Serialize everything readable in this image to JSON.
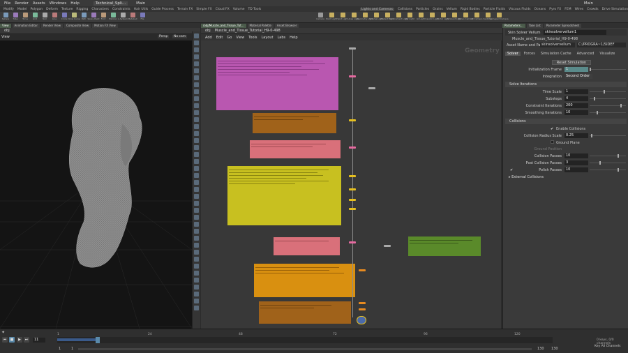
{
  "menu": [
    "File",
    "Render",
    "Assets",
    "Windows",
    "Help"
  ],
  "desktop": {
    "tab": "Technical_Spli...",
    "main": "Main",
    "right_main": "Main"
  },
  "shelf_tabs_left": [
    "Modify",
    "Model",
    "Polygon",
    "Deform",
    "Texture",
    "Rigging",
    "Characters",
    "Constraints",
    "Hair Utils",
    "Guide Process",
    "Terrain FX",
    "Simple FX",
    "Cloud FX",
    "Volume",
    "TD Tools"
  ],
  "shelf_tabs_right": [
    "Lights and Cameras",
    "Collisions",
    "Particles",
    "Grains",
    "Vellum",
    "Rigid Bodies",
    "Particle Fluids",
    "Viscous Fluids",
    "Oceans",
    "Pyro FX",
    "FEM",
    "Wires",
    "Crowds",
    "Drive Simulation"
  ],
  "shelf_tools_left": [
    "Sphere",
    "Tube",
    "Torus",
    "Grid",
    "Null",
    "Line",
    "Circle",
    "Draw Curve",
    "Path",
    "Spray Paint",
    "Font",
    "Platonic",
    "L-System",
    "Metaball",
    "File"
  ],
  "shelf_tools_right": [
    "Camera",
    "Point Light",
    "Spot Light",
    "Area Light",
    "Geometry Light",
    "Volume Light",
    "Distant Light",
    "Environment Light",
    "Sky Light",
    "GI Light",
    "Caustic Light",
    "Portal Light",
    "Ambient Light",
    "Stereo Camera",
    "VR Camera",
    "Switcher",
    "Gamepad Camera"
  ],
  "left_tabs": [
    "View",
    "Animation Editor",
    "Render View",
    "Composite View",
    "Motion FX View"
  ],
  "left_path": "obj",
  "viewport": {
    "persp": "Persp",
    "cam": "No cam"
  },
  "network_tabs": [
    "/obj/Muscle_and_Tissue_Tut...",
    "Material Palette",
    "Asset Browser"
  ],
  "network_path": [
    "obj",
    "Muscle_and_Tissue_Tutorial_H9-0-498"
  ],
  "network_menu": [
    "Add",
    "Edit",
    "Go",
    "View",
    "Tools",
    "Layout",
    "Labs",
    "Help"
  ],
  "network_watermark": "Geometry",
  "right_top_tabs": [
    "Take List",
    "Parameter Spreadsheet"
  ],
  "params": {
    "tabs_top": [
      "Parameters..."
    ],
    "node_type": "Skin Solver Vellum",
    "node_name": "skinsolvervellum1",
    "path_label": "Muscle_and_Tissue_Tutorial_H9-0-498",
    "asset_label": "Asset Name and Path",
    "asset_value": "skinsolvervellum",
    "asset_path": "C:/PROGRA~1/SIDEF",
    "tabs": [
      "Solver",
      "Forces",
      "Simulation Cache",
      "Advanced",
      "Visualize"
    ],
    "reset_button": "Reset Simulation",
    "init_frame_label": "Initialization Frame",
    "init_frame_value": "1",
    "integration_label": "Integration",
    "integration_value": "Second Order",
    "solve_iterations_section": "Solve Iterations",
    "time_scale_label": "Time Scale",
    "time_scale_value": "1",
    "substeps_label": "Substeps",
    "substeps_value": "4",
    "constraint_iter_label": "Constraint Iterations",
    "constraint_iter_value": "200",
    "smoothing_iter_label": "Smoothing Iterations",
    "smoothing_iter_value": "10",
    "collisions_section": "Collisions",
    "enable_collisions_label": "Enable Collisions",
    "collision_radius_label": "Collision Radius Scale",
    "collision_radius_value": "0.25",
    "ground_plane_label": "Ground Plane",
    "ground_position_label": "Ground Position",
    "collision_passes_label": "Collision Passes",
    "collision_passes_value": "10",
    "post_collision_label": "Post Collision Passes",
    "post_collision_value": "3",
    "polish_passes_label": "Polish Passes",
    "polish_passes_value": "10",
    "external_collisions_section": "External Collisions"
  },
  "timeline": {
    "current_frame": "11",
    "ticks": [
      "1",
      "24",
      "48",
      "72",
      "96",
      "120"
    ],
    "start": "1",
    "start2": "1",
    "end": "130",
    "end2": "130",
    "keys_info": "0 keys, 0/0 channels",
    "all_channels": "Key All Channels"
  },
  "colors": {
    "accent": "#5a8a8a",
    "sticky_magenta": "#b957b0",
    "sticky_brown": "#a0621a",
    "sticky_pink": "#d9707a",
    "sticky_yellow": "#c8c020",
    "sticky_orange": "#d99010",
    "sticky_green": "#5a8a2a",
    "node_pink": "#e66aa0",
    "node_yellow": "#e6c020",
    "node_orange": "#e68a20"
  }
}
